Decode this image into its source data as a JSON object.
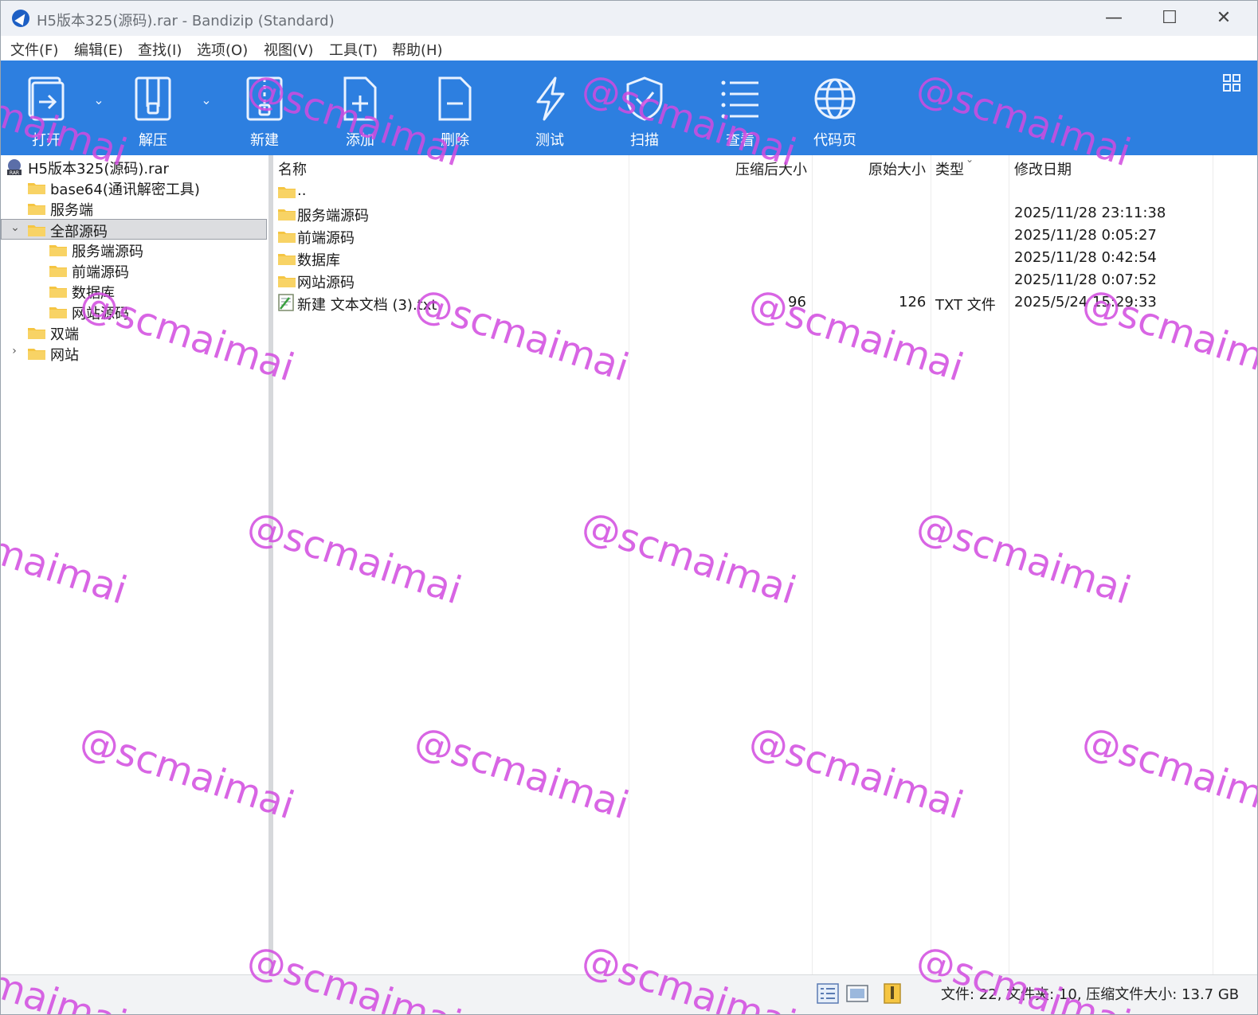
{
  "window": {
    "title": "H5版本325(源码).rar - Bandizip (Standard)",
    "controls": {
      "minimize": "—",
      "maximize": "☐",
      "close": "✕"
    }
  },
  "menu": [
    "文件(F)",
    "编辑(E)",
    "查找(I)",
    "选项(O)",
    "视图(V)",
    "工具(T)",
    "帮助(H)"
  ],
  "toolbar": {
    "buttons": [
      {
        "label": "打开",
        "icon": "open-icon"
      },
      {
        "label": "解压",
        "icon": "extract-icon"
      },
      {
        "label": "新建",
        "icon": "new-archive-icon"
      },
      {
        "label": "添加",
        "icon": "add-file-icon"
      },
      {
        "label": "删除",
        "icon": "delete-file-icon"
      },
      {
        "label": "测试",
        "icon": "test-lightning-icon"
      },
      {
        "label": "扫描",
        "icon": "scan-shield-icon"
      },
      {
        "label": "查看",
        "icon": "view-list-icon"
      },
      {
        "label": "代码页",
        "icon": "codepage-globe-icon"
      }
    ],
    "dropdown_arrow": "⌄"
  },
  "tree": {
    "root": "H5版本325(源码).rar",
    "items": [
      {
        "label": "base64(通讯解密工具)",
        "level": 1
      },
      {
        "label": "服务端",
        "level": 1
      },
      {
        "label": "全部源码",
        "level": 1,
        "expanded": true,
        "selected": true
      },
      {
        "label": "服务端源码",
        "level": 2
      },
      {
        "label": "前端源码",
        "level": 2
      },
      {
        "label": "数据库",
        "level": 2
      },
      {
        "label": "网站源码",
        "level": 2
      },
      {
        "label": "双端",
        "level": 1
      },
      {
        "label": "网站",
        "level": 1,
        "collapsed_expander": true
      }
    ],
    "expanded_glyph": "⌄",
    "collapsed_glyph": "›"
  },
  "list": {
    "columns": [
      "名称",
      "压缩后大小",
      "原始大小",
      "类型",
      "修改日期"
    ],
    "rows": [
      {
        "name": "..",
        "packed": "",
        "size": "",
        "type": "",
        "modified": "",
        "kind": "folder"
      },
      {
        "name": "服务端源码",
        "packed": "",
        "size": "",
        "type": "",
        "modified": "2025/11/28 23:11:38",
        "kind": "folder"
      },
      {
        "name": "前端源码",
        "packed": "",
        "size": "",
        "type": "",
        "modified": "2025/11/28 0:05:27",
        "kind": "folder"
      },
      {
        "name": "数据库",
        "packed": "",
        "size": "",
        "type": "",
        "modified": "2025/11/28 0:42:54",
        "kind": "folder"
      },
      {
        "name": "网站源码",
        "packed": "",
        "size": "",
        "type": "",
        "modified": "2025/11/28 0:07:52",
        "kind": "folder"
      },
      {
        "name": "新建 文本文档 (3).txt",
        "packed": "96",
        "size": "126",
        "type": "TXT 文件",
        "modified": "2025/5/24 15:29:33",
        "kind": "txt"
      }
    ]
  },
  "status": {
    "text": "文件: 22, 文件夹: 10, 压缩文件大小: 13.7 GB"
  },
  "watermark": "@scmaimai",
  "colors": {
    "toolbar_bg": "#2d7fe0",
    "folder": "#f5c542",
    "watermark": "#d24be0"
  }
}
